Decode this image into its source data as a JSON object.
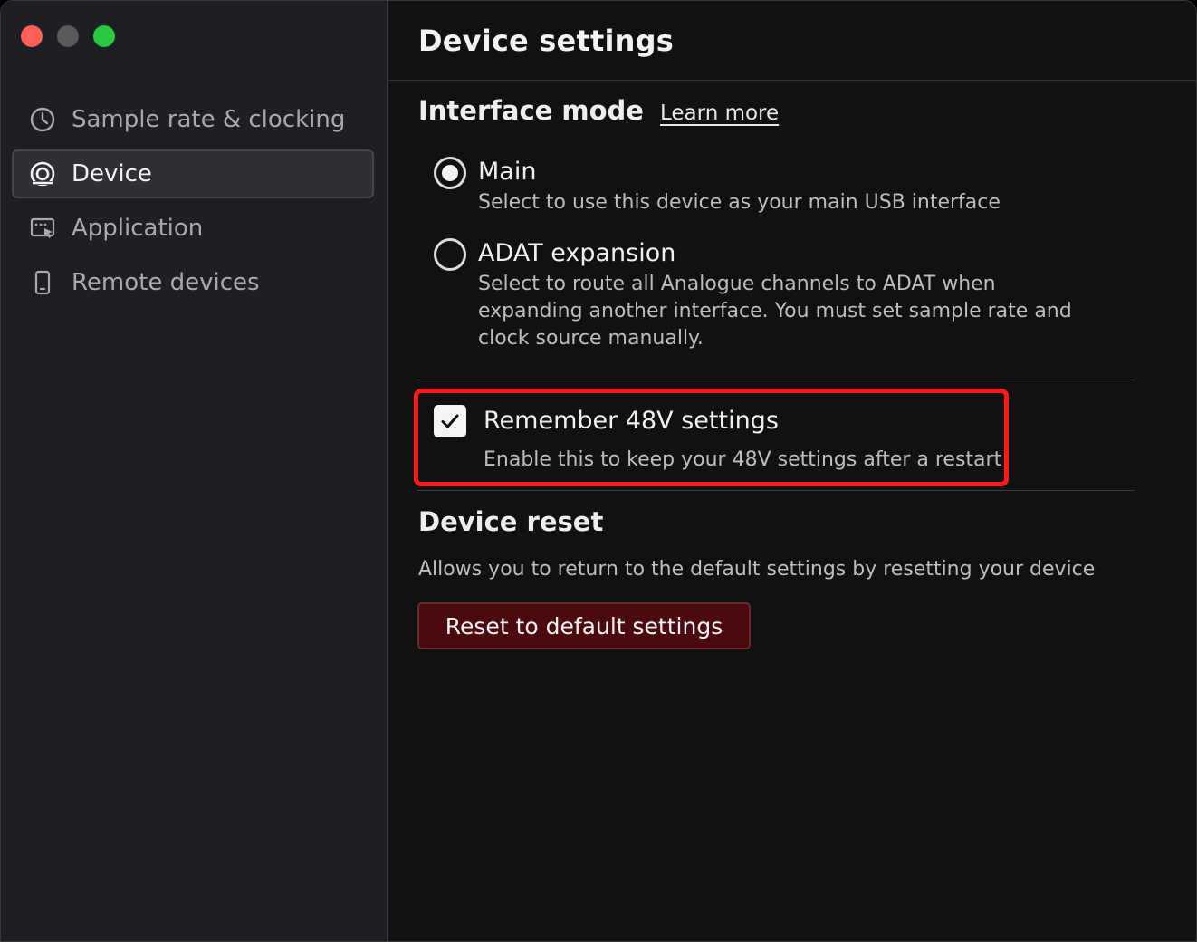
{
  "sidebar": {
    "items": [
      {
        "label": "Sample rate & clocking",
        "icon": "clock-icon",
        "active": false
      },
      {
        "label": "Device",
        "icon": "device-icon",
        "active": true
      },
      {
        "label": "Application",
        "icon": "application-icon",
        "active": false
      },
      {
        "label": "Remote devices",
        "icon": "phone-icon",
        "active": false
      }
    ]
  },
  "header": {
    "title": "Device settings"
  },
  "interface_mode": {
    "title": "Interface mode",
    "learn_more": "Learn more",
    "options": [
      {
        "label": "Main",
        "description": "Select to use this device as your main USB interface",
        "selected": true
      },
      {
        "label": "ADAT expansion",
        "description": "Select to route all Analogue channels to ADAT when expanding another interface. You must set sample rate and clock source manually.",
        "selected": false
      }
    ]
  },
  "remember_48v": {
    "label": "Remember 48V settings",
    "description": "Enable this to keep your 48V settings after a restart",
    "checked": true,
    "highlight_color": "#ff1a1a"
  },
  "device_reset": {
    "title": "Device reset",
    "description": "Allows you to return to the default settings by resetting your device",
    "button_label": "Reset to default settings",
    "button_color": "#4a0a10"
  }
}
